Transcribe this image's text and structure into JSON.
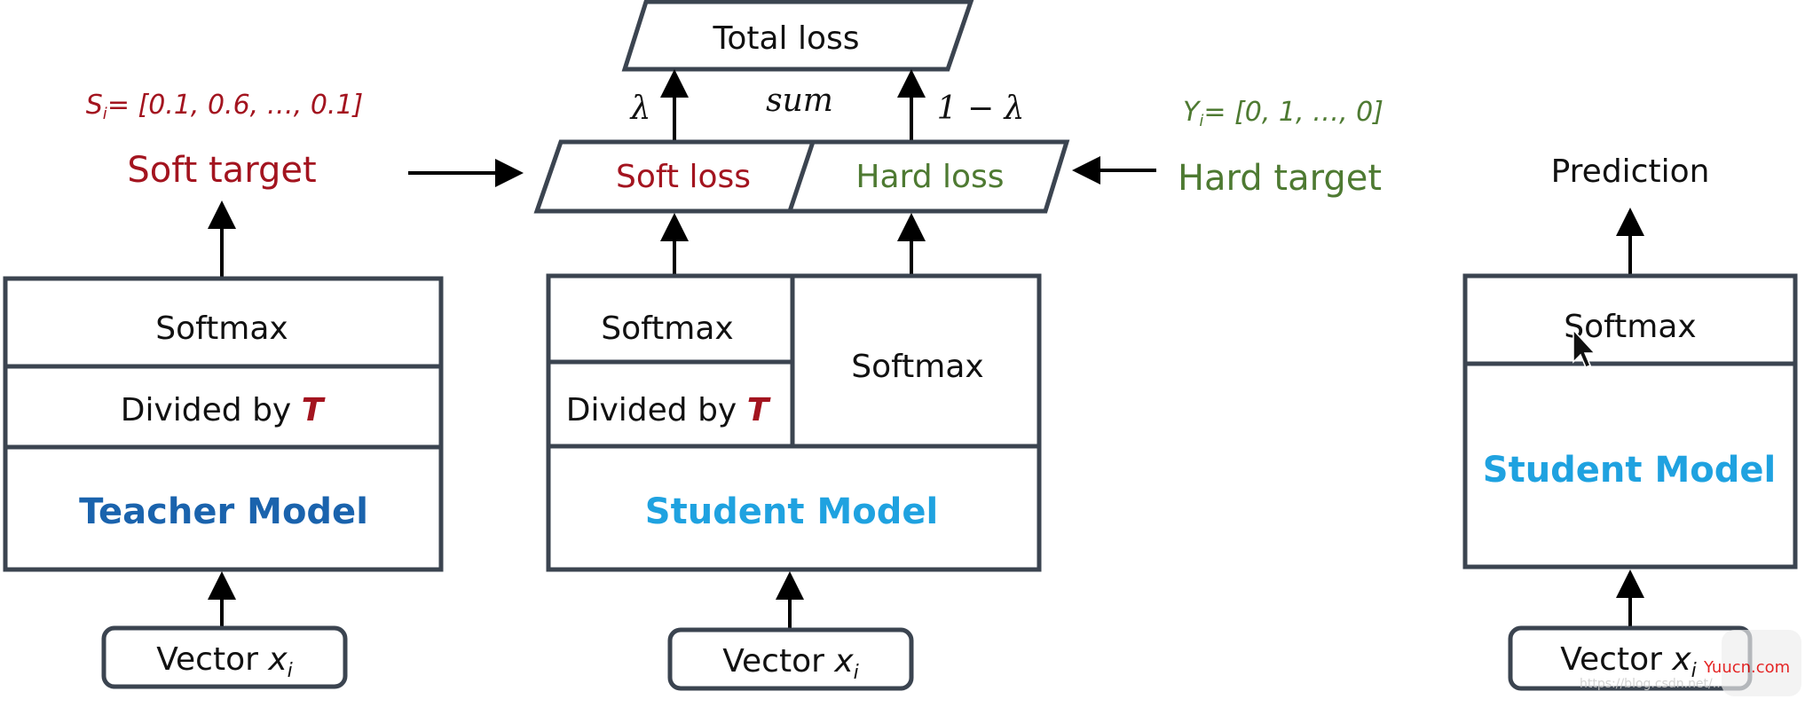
{
  "colors": {
    "soft": "#a3141f",
    "hard": "#4e7a32",
    "teacher": "#1a63ad",
    "student": "#1fa2e0",
    "border": "#3b4450"
  },
  "top": {
    "total_loss": "Total loss",
    "lambda": "λ",
    "sum": "sum",
    "one_minus_lambda": "1 − λ",
    "soft_loss": "Soft loss",
    "hard_loss": "Hard loss"
  },
  "soft_target": {
    "formula_symbol": "S",
    "formula_sub": "i",
    "formula_value": "= [0.1, 0.6, …, 0.1]",
    "label": "Soft target"
  },
  "hard_target": {
    "formula_symbol": "Y",
    "formula_sub": "i",
    "formula_value": "= [0, 1, …, 0]",
    "label": "Hard target"
  },
  "teacher": {
    "softmax": "Softmax",
    "divided_by": "Divided by",
    "temperature": "T",
    "model": "Teacher Model"
  },
  "student_train": {
    "softmax_soft": "Softmax",
    "divided_by": "Divided by",
    "temperature": "T",
    "softmax_hard": "Softmax",
    "model": "Student Model"
  },
  "student_infer": {
    "prediction": "Prediction",
    "softmax": "Softmax",
    "model": "Student Model"
  },
  "input": {
    "label": "Vector",
    "var": "x",
    "sub": "i"
  },
  "watermark": {
    "brand": "Yuucn.com",
    "url": "https://blog.csdn.net/..."
  }
}
